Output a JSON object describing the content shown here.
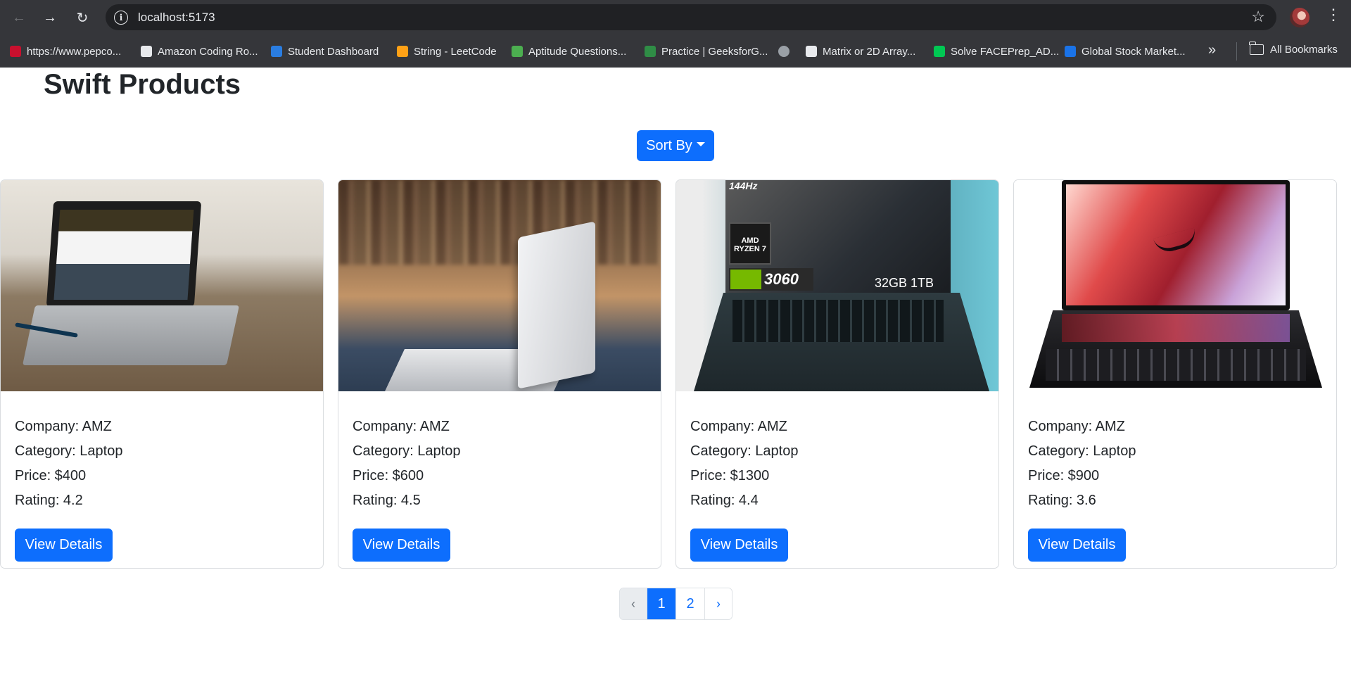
{
  "browser": {
    "url": "localhost:5173",
    "bookmarks": [
      {
        "label": "https://www.pepco...",
        "color": "#c8102e"
      },
      {
        "label": "Amazon Coding Ro...",
        "color": "#e8eaed"
      },
      {
        "label": "Student Dashboard",
        "color": "#2a7de1"
      },
      {
        "label": "String - LeetCode",
        "color": "#ffa116"
      },
      {
        "label": "Aptitude Questions...",
        "color": "#4caf50"
      },
      {
        "label": "Practice | GeeksforG...",
        "color": "#2f8d46"
      },
      {
        "label": "",
        "color": "#9aa0a6"
      },
      {
        "label": "Matrix or 2D Array...",
        "color": "#e8eaed"
      },
      {
        "label": "Solve FACEPrep_AD...",
        "color": "#00c853"
      },
      {
        "label": "Global Stock Market...",
        "color": "#1a73e8"
      }
    ],
    "all_bookmarks": "All Bookmarks"
  },
  "page": {
    "title": "Swift Products",
    "sort_label": "Sort By"
  },
  "products": [
    {
      "company": "Company: AMZ",
      "category": "Category: Laptop",
      "price": "Price: $400",
      "rating": "Rating: 4.2",
      "button": "View Details",
      "image": "laptop-on-wooden-desk"
    },
    {
      "company": "Company: AMZ",
      "category": "Category: Laptop",
      "price": "Price: $600",
      "rating": "Rating: 4.5",
      "button": "View Details",
      "image": "silver-laptop-in-room"
    },
    {
      "company": "Company: AMZ",
      "category": "Category: Laptop",
      "price": "Price: $1300",
      "rating": "Rating: 4.4",
      "button": "View Details",
      "image": "gaming-laptop-teal"
    },
    {
      "company": "Company: AMZ",
      "category": "Category: Laptop",
      "price": "Price: $900",
      "rating": "Rating: 3.6",
      "button": "View Details",
      "image": "rog-laptop"
    }
  ],
  "product_image_text": {
    "hz": "144Hz",
    "ryzen": "AMD RYZEN 7",
    "rtx": "3060",
    "spec": "32GB 1TB"
  },
  "pagination": {
    "prev": "‹",
    "pages": [
      "1",
      "2"
    ],
    "active": "1",
    "next": "›"
  },
  "colors": {
    "primary": "#0d6efd",
    "chrome": "#35363a"
  }
}
